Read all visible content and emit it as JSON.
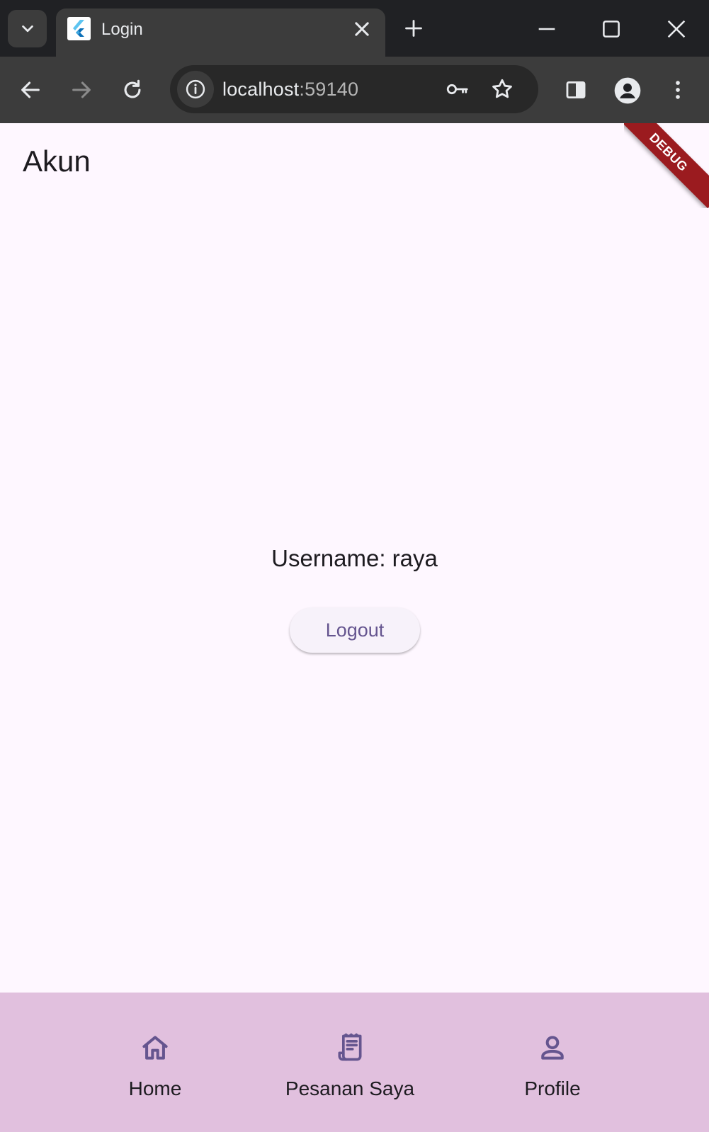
{
  "browser": {
    "tab_title": "Login",
    "url_host": "localhost",
    "url_port": ":59140"
  },
  "app": {
    "page_title": "Akun",
    "debug_label": "DEBUG",
    "username_text": "Username: raya",
    "logout_label": "Logout"
  },
  "bottom_nav": {
    "items": [
      {
        "label": "Home",
        "icon": "home-icon"
      },
      {
        "label": "Pesanan Saya",
        "icon": "receipt-icon"
      },
      {
        "label": "Profile",
        "icon": "person-icon"
      }
    ]
  },
  "colors": {
    "accent": "#65558f",
    "nav_background": "#e1c0de",
    "page_background": "#fef7ff",
    "debug_banner": "#9b1b1f"
  }
}
